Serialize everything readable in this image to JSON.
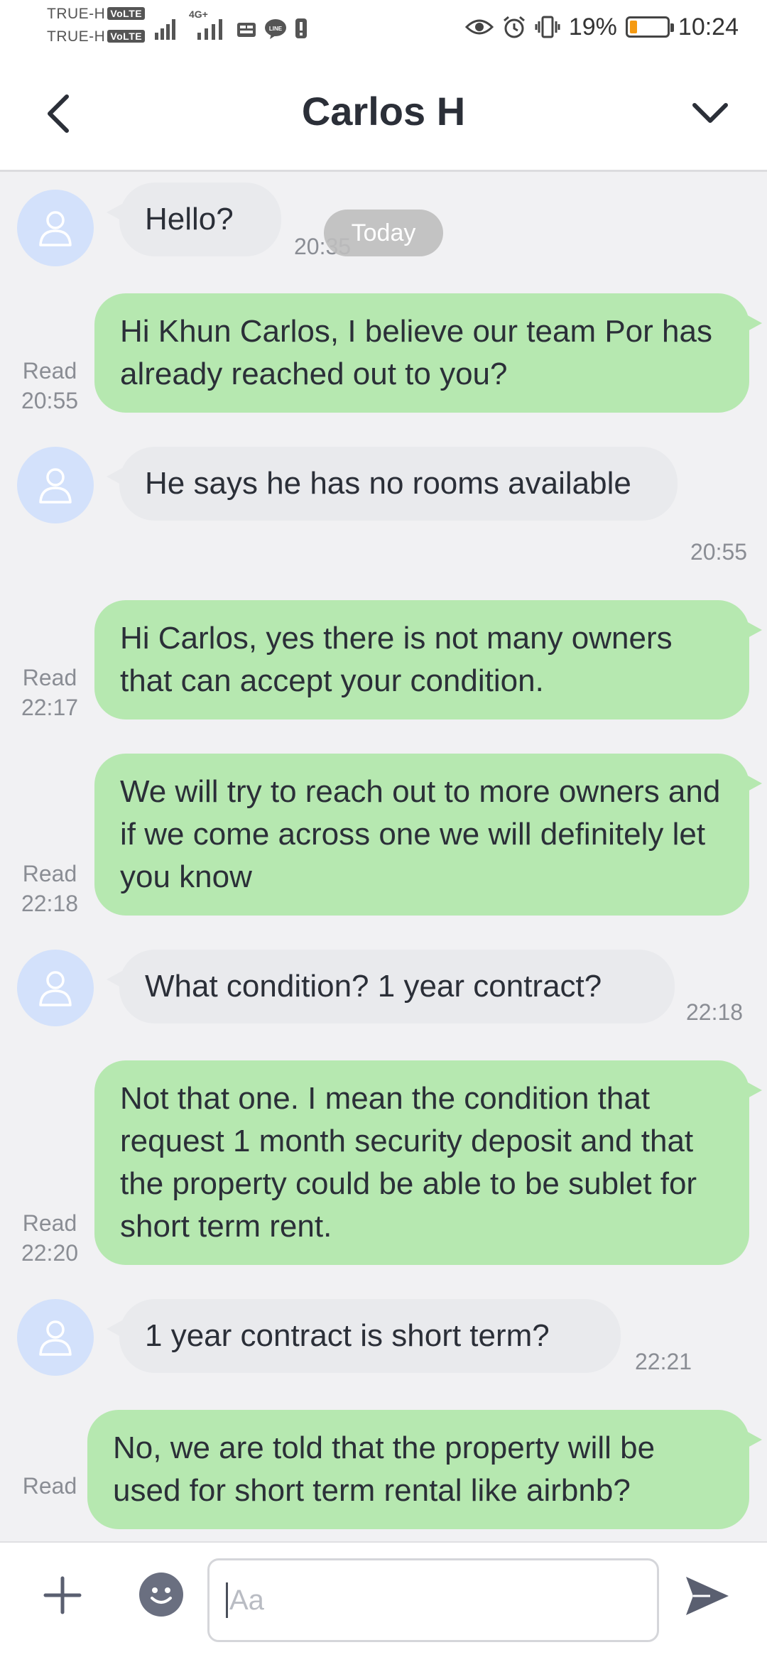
{
  "status_bar": {
    "carrier_1": "TRUE-H",
    "carrier_2": "TRUE-H",
    "volte_badge": "VoLTE",
    "network_badge": "4G+",
    "battery_percent": "19%",
    "battery_level": 0.19,
    "time": "10:24",
    "accent_battery": "#f59a12"
  },
  "header": {
    "title": "Carlos H",
    "back_icon": "chevron-left-icon",
    "menu_icon": "chevron-down-icon"
  },
  "chat": {
    "date_separator": "Today",
    "messages": [
      {
        "direction": "in",
        "text": "Hello?",
        "time": "20:35"
      },
      {
        "direction": "out",
        "text": "Hi Khun Carlos, I believe our team Por has already reached out to you?",
        "status": "Read",
        "time": "20:55"
      },
      {
        "direction": "in",
        "text": "He says he has no rooms available",
        "time": "20:55"
      },
      {
        "direction": "out",
        "text": "Hi Carlos, yes there is not many owners that can accept your condition.",
        "status": "Read",
        "time": "22:17"
      },
      {
        "direction": "out",
        "text": "We will try to reach out to more owners and if we come across one we will definitely let you know",
        "status": "Read",
        "time": "22:18"
      },
      {
        "direction": "in",
        "text": "What condition? 1 year contract?",
        "time": "22:18"
      },
      {
        "direction": "out",
        "text": "Not that one. I mean the condition that request 1 month security deposit and that the property could be able to be sublet for short term rent.",
        "status": "Read",
        "time": "22:20"
      },
      {
        "direction": "in",
        "text": "1 year contract is short term?",
        "time": "22:21"
      },
      {
        "direction": "out",
        "text": "No, we are told that the property will be used for short term rental like airbnb?",
        "status": "Read",
        "time": ""
      }
    ],
    "colors": {
      "outgoing_bubble": "#b6e8b0",
      "incoming_bubble": "#e9eaed",
      "avatar_bg": "#d3e1fb"
    }
  },
  "input_bar": {
    "placeholder": "Aa",
    "value": "",
    "add_icon": "plus-icon",
    "emoji_icon": "smiley-icon",
    "send_icon": "send-icon"
  }
}
